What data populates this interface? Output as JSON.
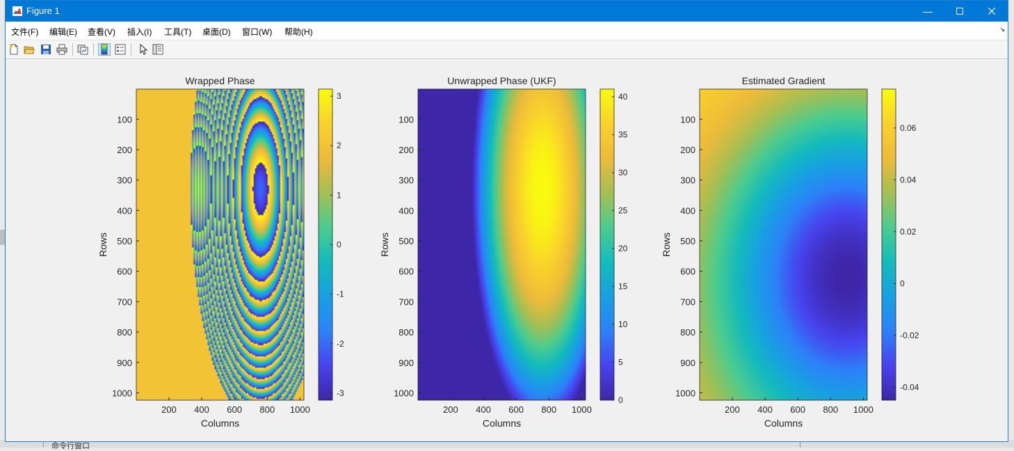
{
  "window": {
    "title": "Figure 1"
  },
  "menu": [
    "文件(F)",
    "编辑(E)",
    "查看(V)",
    "插入(I)",
    "工具(T)",
    "桌面(D)",
    "窗口(W)",
    "帮助(H)"
  ],
  "toolbar": {
    "icons": [
      "new-figure-icon",
      "open-file-icon",
      "save-icon",
      "print-icon",
      "link-plot-icon",
      "insert-colorbar-icon",
      "insert-legend-icon",
      "select-arrow-icon",
      "property-inspector-icon"
    ]
  },
  "background_app": {
    "command_window_label": "命令行窗口"
  },
  "colormap": "parula",
  "chart_data": [
    {
      "type": "heatmap",
      "title": "Wrapped Phase",
      "xlabel": "Columns",
      "ylabel": "Rows",
      "xlim": [
        1,
        1024
      ],
      "ylim": [
        1,
        1024
      ],
      "y_reversed": true,
      "xticks": [
        200,
        400,
        600,
        800,
        1000
      ],
      "yticks": [
        100,
        200,
        300,
        400,
        500,
        600,
        700,
        800,
        900,
        1000
      ],
      "colorbar": {
        "range": [
          -3.1416,
          3.1416
        ],
        "ticks": [
          -3,
          -2,
          -1,
          0,
          1,
          2,
          3
        ],
        "tick_labels": [
          "-3",
          "-2",
          "-1",
          "0",
          "1",
          "2",
          "3"
        ]
      },
      "description_values": {
        "pattern": "wrapped",
        "peak_col": 760,
        "peak_row": 330
      }
    },
    {
      "type": "heatmap",
      "title": "Unwrapped Phase (UKF)",
      "xlabel": "Columns",
      "ylabel": "Rows",
      "xlim": [
        1,
        1024
      ],
      "ylim": [
        1,
        1024
      ],
      "y_reversed": true,
      "xticks": [
        200,
        400,
        600,
        800,
        1000
      ],
      "yticks": [
        100,
        200,
        300,
        400,
        500,
        600,
        700,
        800,
        900,
        1000
      ],
      "colorbar": {
        "range": [
          0,
          41
        ],
        "ticks": [
          0,
          5,
          10,
          15,
          20,
          25,
          30,
          35,
          40
        ],
        "tick_labels": [
          "0",
          "5",
          "10",
          "15",
          "20",
          "25",
          "30",
          "35",
          "40"
        ]
      },
      "description_values": {
        "pattern": "unwrapped",
        "peak_col": 760,
        "peak_row": 330
      }
    },
    {
      "type": "heatmap",
      "title": "Estimated Gradient",
      "xlabel": "Columns",
      "ylabel": "Rows",
      "xlim": [
        1,
        1024
      ],
      "ylim": [
        1,
        1024
      ],
      "y_reversed": true,
      "xticks": [
        200,
        400,
        600,
        800,
        1000
      ],
      "yticks": [
        100,
        200,
        300,
        400,
        500,
        600,
        700,
        800,
        900,
        1000
      ],
      "colorbar": {
        "range": [
          -0.045,
          0.075
        ],
        "ticks": [
          -0.04,
          -0.02,
          0,
          0.02,
          0.04,
          0.06
        ],
        "tick_labels": [
          "-0.04",
          "-0.02",
          "0",
          "0.02",
          "0.04",
          "0.06"
        ]
      },
      "description_values": {
        "pattern": "gradient"
      }
    }
  ]
}
